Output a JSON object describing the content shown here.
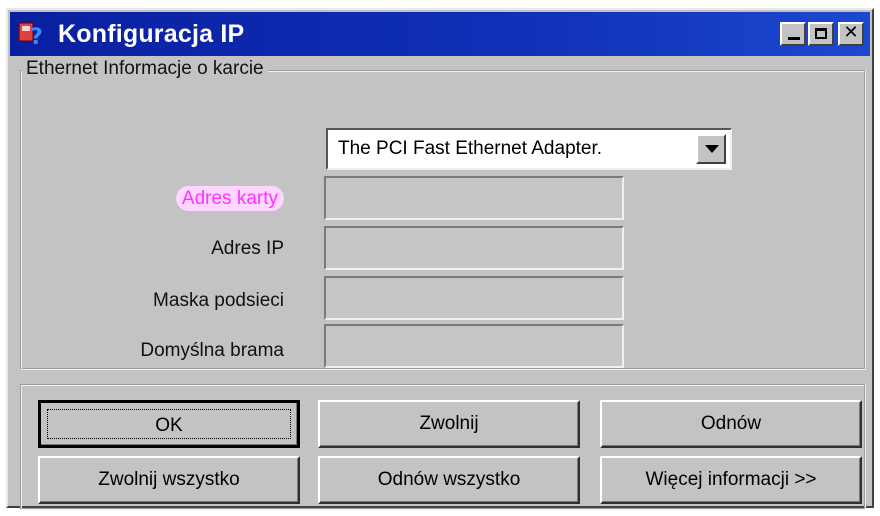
{
  "window": {
    "title": "Konfiguracja IP",
    "icon": "network-help-icon"
  },
  "group": {
    "legend": "Ethernet  Informacje o karcie"
  },
  "adapter_select": {
    "value": "The PCI Fast Ethernet Adapter."
  },
  "fields": [
    {
      "label": "Adres karty",
      "value": ""
    },
    {
      "label": "Adres IP",
      "value": ""
    },
    {
      "label": "Maska podsieci",
      "value": ""
    },
    {
      "label": "Domyślna brama",
      "value": ""
    }
  ],
  "buttons": {
    "ok": "OK",
    "release": "Zwolnij",
    "renew": "Odnów",
    "release_all": "Zwolnij wszystko",
    "renew_all": "Odnów wszystko",
    "more_info": "Więcej informacji >>"
  },
  "colors": {
    "titlebar": "#0a1fa0",
    "face": "#c3c3c3",
    "highlight_label": "#ff33ff"
  }
}
